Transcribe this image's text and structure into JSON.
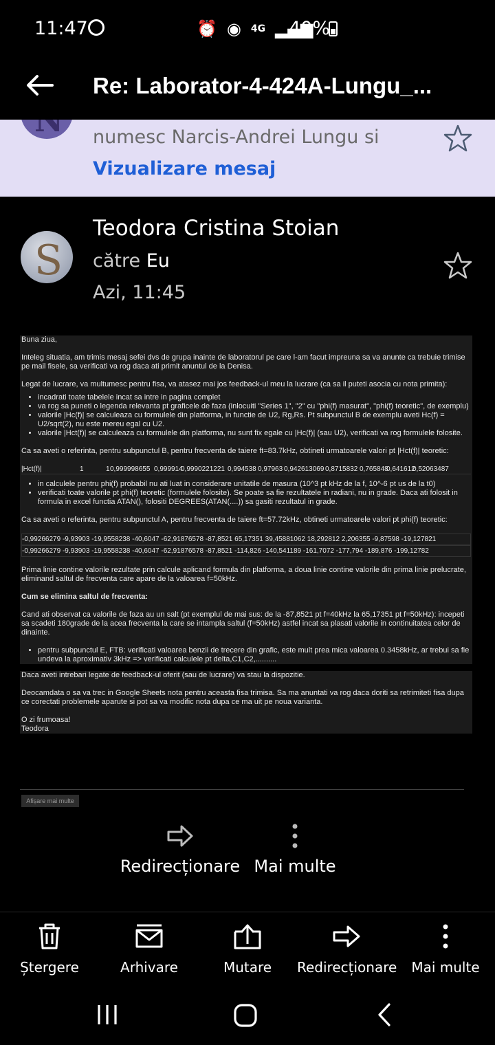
{
  "status_bar": {
    "time": "11:47",
    "network": "4G",
    "battery": "40%"
  },
  "header": {
    "title": "Re: Laborator-4-424A-Lungu_..."
  },
  "previous_message": {
    "snippet": "numesc Narcis-Andrei Lungu si",
    "view_link": "Vizualizare mesaj",
    "avatar_letter": "N"
  },
  "sender": {
    "name": "Teodora Cristina Stoian",
    "to_prefix": "către",
    "to_name": "Eu",
    "date": "Azi, 11:45",
    "avatar_letter": "S"
  },
  "body": {
    "greeting": "Buna ziua,",
    "p1": "Inteleg situatia, am trimis mesaj sefei dvs de grupa inainte de laboratorul pe care l-am facut impreuna sa va anunte ca trebuie trimise pe mail fisele, sa verificati va rog daca ati primit anuntul de la Denisa.",
    "p2": "Legat de lucrare, va multumesc pentru fisa, va atasez mai jos feedback-ul meu la lucrare (ca sa il puteti asocia cu nota primita):",
    "list1": [
      "incadrati toate tabelele incat sa intre in pagina complet",
      "va rog sa puneti o legenda relevanta pt graficele de faza (inlocuiti \"Series 1\", \"2\" cu \"phi(f) masurat\", \"phi(f) teoretic\", de exemplu)",
      "valorile |Hc(f)| se calculeaza cu formulele din platforma, in functie de U2, Rg,Rs. Pt subpunctul B de exemplu aveti Hc(f) = U2/sqrt(2), nu este mereu egal cu U2.",
      "valorile |Hct(f)| se calculeaza cu formulele din platforma, nu sunt fix egale cu |Hc(f)| (sau U2), verificati va rog formulele folosite."
    ],
    "p3": "Ca sa aveti o referinta, pentru subpunctul B, pentru frecventa de taiere ft=83.7kHz, obtineti urmatoarele valori pt |Hct(f)| teoretic:",
    "table_b": [
      "|Hct(f)|",
      "1",
      "1",
      "0,999998655",
      "0,999914",
      "0,9990221221",
      "0,994538",
      "0,97963",
      "0,942613069",
      "0,8715832",
      "0,765848",
      "0,641612",
      "0,52063487"
    ],
    "list2": [
      "in calculele pentru phi(f) probabil nu ati luat in considerare unitatile de masura (10^3 pt kHz de la f, 10^-6 pt us de la t0)",
      "verificati toate valorile pt phi(f) teoretic (formulele folosite). Se poate sa fie rezultatele in radiani, nu in grade. Daca ati folosit in formula in excel functia ATAN(), folositi DEGREES(ATAN(....)) sa gasiti rezultatul in grade."
    ],
    "p4": "Ca sa aveti o referinta, pentru subpunctul A, pentru frecventa de taiere ft=57.72kHz, obtineti urmatoarele valori pt phi(f) teoretic:",
    "table_a_row1": "-0,99266279 -9,93903 -19,9558238 -40,6047 -62,91876578 -87,8521 65,17351 39,45881062 18,292812 2,206355 -9,87598 -19,127821",
    "table_a_row2": "-0,99266279 -9,93903 -19,9558238 -40,6047 -62,91876578 -87,8521  -114,826  -140,541189  -161,7072  -177,794 -189,876 -199,12782",
    "p5": "Prima linie contine valorile rezultate prin calcule aplicand formula din platforma, a doua linie contine valorile din prima linie prelucrate, eliminand saltul de frecventa care apare de la valoarea f=50kHz.",
    "heading": "Cum se elimina saltul de frecventa:",
    "p6": "Cand ati observat ca valorile de faza au un salt (pt exemplul de mai sus: de la -87,8521 pt f=40kHz la 65,17351 pt f=50kHz): incepeti sa scadeti 180grade de la acea frecventa la care se intampla saltul (f=50kHz) astfel incat sa plasati valorile in continuitatea celor de dinainte.",
    "list3": [
      "pentru subpunctul E, FTB: verificati valoarea benzii de trecere din grafic, este mult prea mica valoarea 0.3458kHz, ar trebui sa fie undeva la aproximativ 3kHz => verificati calculele pt delta,C1,C2,.........."
    ],
    "p7": "Daca aveti intrebari legate de feedback-ul oferit (sau de lucrare) va stau la dispozitie.",
    "p8": "Deocamdata o sa va trec in Google Sheets nota pentru aceasta fisa trimisa. Sa ma anuntati va rog daca doriti sa retrimiteti fisa dupa ce corectati problemele aparute si pot sa va modific nota dupa ce ma uit pe noua varianta.",
    "closing1": "O zi frumoasa!",
    "closing2": "Teodora",
    "show_more": "Afișare mai multe"
  },
  "inline_actions": {
    "forward": "Redirecționare",
    "more": "Mai multe"
  },
  "toolbar": {
    "delete": "Ștergere",
    "archive": "Arhivare",
    "move": "Mutare",
    "forward": "Redirecționare",
    "more": "Mai multe"
  }
}
